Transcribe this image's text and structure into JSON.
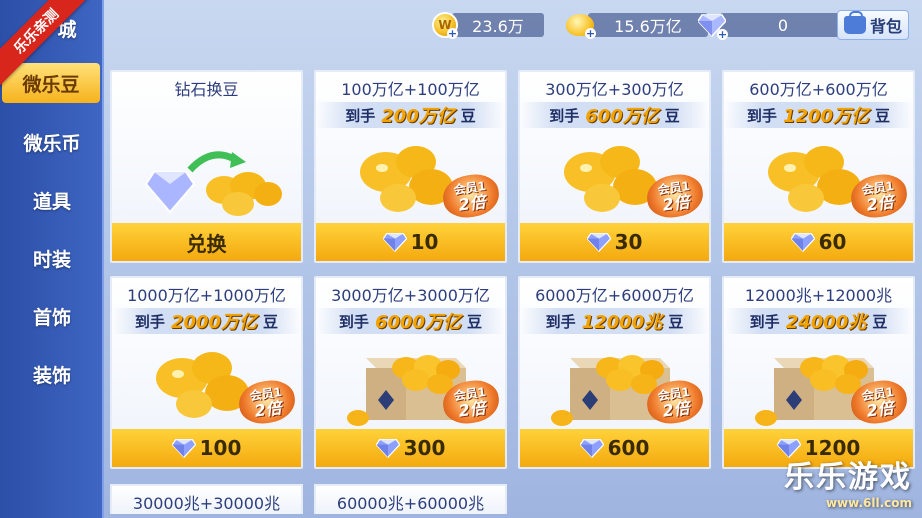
{
  "corner_badge": "乐乐亲测",
  "sidebar": {
    "top_partial": "城",
    "items": [
      {
        "label": "微乐豆",
        "active": true
      },
      {
        "label": "微乐币",
        "active": false
      },
      {
        "label": "道具",
        "active": false
      },
      {
        "label": "时装",
        "active": false
      },
      {
        "label": "首饰",
        "active": false
      },
      {
        "label": "装饰",
        "active": false
      }
    ]
  },
  "resources": {
    "coin": "23.6万",
    "beans": "15.6万亿",
    "diamonds": "0",
    "coin_icon_letter": "W"
  },
  "bag_label": "背包",
  "cards": [
    {
      "title": "钻石换豆",
      "sub": null,
      "foot": "兑换",
      "foot_gem": false,
      "vip": false
    },
    {
      "title": "100万亿+100万亿",
      "sub_prefix": "到手",
      "sub_amount": "200万亿",
      "sub_suffix": "豆",
      "foot": "10",
      "foot_gem": true,
      "vip": true
    },
    {
      "title": "300万亿+300万亿",
      "sub_prefix": "到手",
      "sub_amount": "600万亿",
      "sub_suffix": "豆",
      "foot": "30",
      "foot_gem": true,
      "vip": true
    },
    {
      "title": "600万亿+600万亿",
      "sub_prefix": "到手",
      "sub_amount": "1200万亿",
      "sub_suffix": "豆",
      "foot": "60",
      "foot_gem": true,
      "vip": true
    },
    {
      "title": "1000万亿+1000万亿",
      "sub_prefix": "到手",
      "sub_amount": "2000万亿",
      "sub_suffix": "豆",
      "foot": "100",
      "foot_gem": true,
      "vip": true
    },
    {
      "title": "3000万亿+3000万亿",
      "sub_prefix": "到手",
      "sub_amount": "6000万亿",
      "sub_suffix": "豆",
      "foot": "300",
      "foot_gem": true,
      "vip": true
    },
    {
      "title": "6000万亿+6000万亿",
      "sub_prefix": "到手",
      "sub_amount": "12000兆",
      "sub_suffix": "豆",
      "foot": "600",
      "foot_gem": true,
      "vip": true
    },
    {
      "title": "12000兆+12000兆",
      "sub_prefix": "到手",
      "sub_amount": "24000兆",
      "sub_suffix": "豆",
      "foot": "1200",
      "foot_gem": true,
      "vip": true
    }
  ],
  "vip_badge": {
    "line1": "会员1",
    "line2": "2倍"
  },
  "partial_cards": [
    "30000兆+30000兆",
    "60000兆+60000兆"
  ],
  "watermark": {
    "title": "乐乐游戏",
    "url": "www.6ll.com"
  },
  "colors": {
    "sidebar": "#3e66c2",
    "accent": "#f6b21c",
    "badge": "#d8261c"
  }
}
